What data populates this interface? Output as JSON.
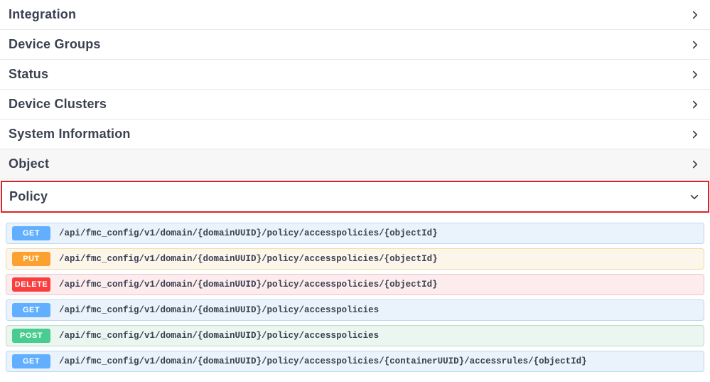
{
  "sections": [
    {
      "title": "Integration",
      "expanded": false,
      "alt": false,
      "highlighted": false
    },
    {
      "title": "Device Groups",
      "expanded": false,
      "alt": false,
      "highlighted": false
    },
    {
      "title": "Status",
      "expanded": false,
      "alt": false,
      "highlighted": false
    },
    {
      "title": "Device Clusters",
      "expanded": false,
      "alt": false,
      "highlighted": false
    },
    {
      "title": "System Information",
      "expanded": false,
      "alt": false,
      "highlighted": false
    },
    {
      "title": "Object",
      "expanded": false,
      "alt": true,
      "highlighted": false
    },
    {
      "title": "Policy",
      "expanded": true,
      "alt": false,
      "highlighted": true
    }
  ],
  "methods": {
    "GET": {
      "label": "GET",
      "cls": "get"
    },
    "PUT": {
      "label": "PUT",
      "cls": "put"
    },
    "DELETE": {
      "label": "DELETE",
      "cls": "delete"
    },
    "POST": {
      "label": "POST",
      "cls": "post"
    }
  },
  "policy_ops": [
    {
      "method": "GET",
      "path": "/api/fmc_config/v1/domain/{domainUUID}/policy/accesspolicies/{objectId}"
    },
    {
      "method": "PUT",
      "path": "/api/fmc_config/v1/domain/{domainUUID}/policy/accesspolicies/{objectId}"
    },
    {
      "method": "DELETE",
      "path": "/api/fmc_config/v1/domain/{domainUUID}/policy/accesspolicies/{objectId}"
    },
    {
      "method": "GET",
      "path": "/api/fmc_config/v1/domain/{domainUUID}/policy/accesspolicies"
    },
    {
      "method": "POST",
      "path": "/api/fmc_config/v1/domain/{domainUUID}/policy/accesspolicies"
    },
    {
      "method": "GET",
      "path": "/api/fmc_config/v1/domain/{domainUUID}/policy/accesspolicies/{containerUUID}/accessrules/{objectId}"
    }
  ]
}
